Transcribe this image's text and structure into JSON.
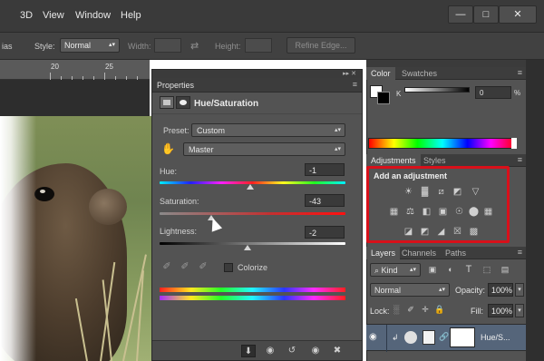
{
  "menu": {
    "items": [
      "3D",
      "View",
      "Window",
      "Help"
    ]
  },
  "window_controls": {
    "minimize": "—",
    "maximize": "□",
    "close": "✕"
  },
  "options": {
    "partial": "ias",
    "style_label": "Style:",
    "style_value": "Normal",
    "width_label": "Width:",
    "height_label": "Height:",
    "refine_label": "Refine Edge..."
  },
  "ruler": {
    "marks": [
      "20",
      "25"
    ]
  },
  "properties": {
    "tab_label": "Properties",
    "adjustment_title": "Hue/Saturation",
    "preset_label": "Preset:",
    "preset_value": "Custom",
    "channel_value": "Master",
    "hue_label": "Hue:",
    "hue_value": "-1",
    "saturation_label": "Saturation:",
    "saturation_value": "-43",
    "lightness_label": "Lightness:",
    "lightness_value": "-2",
    "colorize_label": "Colorize"
  },
  "color_panel": {
    "tabs": [
      "Color",
      "Swatches"
    ],
    "k_label": "K",
    "k_value": "0",
    "k_unit": "%"
  },
  "adjustments_panel": {
    "tabs": [
      "Adjustments",
      "Styles"
    ],
    "title": "Add an adjustment",
    "highlight_color": "#d8101a"
  },
  "layers_panel": {
    "tabs": [
      "Layers",
      "Channels",
      "Paths"
    ],
    "kind_label": "Kind",
    "blend_mode": "Normal",
    "opacity_label": "Opacity:",
    "opacity_value": "100%",
    "lock_label": "Lock:",
    "fill_label": "Fill:",
    "fill_value": "100%",
    "layer_name": "Hue/S..."
  },
  "colors": {
    "ui_dark": "#3a3a3a",
    "panel": "#535353",
    "selected_layer": "#55657a",
    "highlight": "#d8101a"
  }
}
